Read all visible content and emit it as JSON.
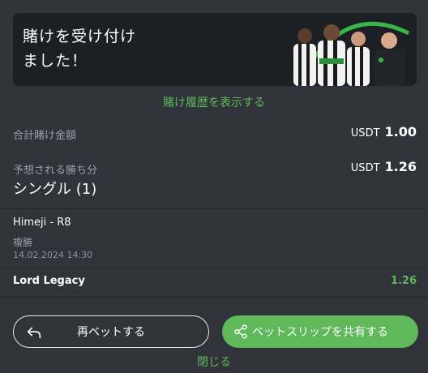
{
  "banner": {
    "title": "賭けを受け付けました！"
  },
  "history_link": "賭け履歴を表示する",
  "summary": {
    "total_stake_label": "合計賭け金額",
    "total_stake_currency": "USDT",
    "total_stake_value": "1.00",
    "expected_win_label": "予想される勝ち分",
    "expected_win_currency": "USDT",
    "expected_win_value": "1.26",
    "bet_type": "シングル (1)"
  },
  "bet": {
    "event": "Himeji - R8",
    "market": "複勝",
    "datetime": "14.02.2024 14:30",
    "selection": "Lord Legacy",
    "odds": "1.26"
  },
  "actions": {
    "rebet_label": "再ベットする",
    "share_label": "ベットスリップを共有する",
    "close_label": "閉じる"
  },
  "colors": {
    "background": "#30333a",
    "banner": "#1c1f24",
    "accent": "#5fb85a",
    "muted_text": "#9aa0a8"
  },
  "icons": {
    "rebet": "undo-arrow-icon",
    "share": "share-icon"
  }
}
